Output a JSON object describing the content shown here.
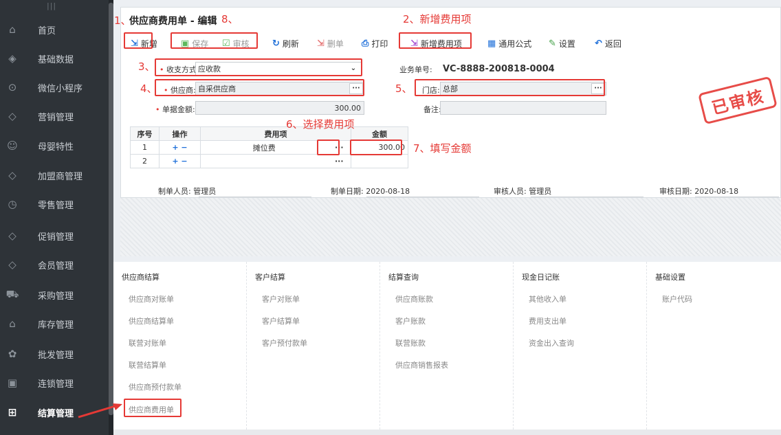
{
  "sidebar": {
    "grip": "|||",
    "items": [
      {
        "label": "首页",
        "icon": "home-icon"
      },
      {
        "label": "基础数据",
        "icon": "layers-icon"
      },
      {
        "label": "微信小程序",
        "icon": "mini-program-icon"
      },
      {
        "label": "营销管理",
        "icon": "diamond-icon"
      },
      {
        "label": "母婴特性",
        "icon": "smile-icon"
      },
      {
        "label": "加盟商管理",
        "icon": "handshake-icon"
      },
      {
        "label": "零售管理",
        "icon": "tag-icon"
      },
      {
        "label": "促销管理",
        "icon": "promo-tag-icon"
      },
      {
        "label": "会员管理",
        "icon": "member-diamond-icon"
      },
      {
        "label": "采购管理",
        "icon": "cart-icon"
      },
      {
        "label": "库存管理",
        "icon": "warehouse-icon"
      },
      {
        "label": "批发管理",
        "icon": "wholesale-icon"
      },
      {
        "label": "连锁管理",
        "icon": "chain-icon"
      },
      {
        "label": "结算管理",
        "icon": "settlement-icon"
      }
    ]
  },
  "form": {
    "title": "供应商费用单 - 编辑",
    "toolbar": {
      "add": "新增",
      "save": "保存",
      "audit": "审核",
      "refresh": "刷新",
      "delete": "删单",
      "print": "打印",
      "add_fee_item": "新增费用项",
      "formula": "通用公式",
      "settings": "设置",
      "back": "返回"
    },
    "fields": {
      "payment_label": "收支方式:",
      "payment_value": "应收款",
      "supplier_label": "供应商:",
      "supplier_value": "自采供应商",
      "amount_label": "单据金额:",
      "amount_value": "300.00",
      "bizno_label": "业务单号:",
      "bizno_value": "VC-8888-200818-0004",
      "store_label": "门店:",
      "store_value": "总部",
      "remark_label": "备注:",
      "remark_value": ""
    },
    "stamp": "已审核",
    "grid": {
      "headers": [
        "序号",
        "操作",
        "费用项",
        "金额"
      ],
      "rows": [
        {
          "no": "1",
          "ops": "+ −",
          "item": "摊位费",
          "dots": "···",
          "amount": "300.00"
        },
        {
          "no": "2",
          "ops": "+ −",
          "item": "",
          "dots": "···",
          "amount": ""
        }
      ]
    },
    "footer": {
      "creator_label": "制单人员:",
      "creator": "管理员",
      "create_date_label": "制单日期:",
      "create_date": "2020-08-18",
      "auditor_label": "审核人员:",
      "auditor": "管理员",
      "audit_date_label": "审核日期:",
      "audit_date": "2020-08-18"
    }
  },
  "annotations": {
    "n1": "1、",
    "n2": "2、新增费用项",
    "n3": "3、",
    "n4": "4、",
    "n5": "5、",
    "n6": "6、选择费用项",
    "n7": "7、填写金额",
    "n8": "8、"
  },
  "menu": {
    "columns": [
      {
        "title": "供应商结算",
        "links": [
          "供应商对账单",
          "供应商结算单",
          "联营对账单",
          "联营结算单",
          "供应商预付款单",
          "供应商费用单"
        ]
      },
      {
        "title": "客户结算",
        "links": [
          "客户对账单",
          "客户结算单",
          "客户预付款单"
        ]
      },
      {
        "title": "结算查询",
        "links": [
          "供应商账款",
          "客户账款",
          "联营账款",
          "供应商销售报表"
        ]
      },
      {
        "title": "现金日记账",
        "links": [
          "其他收入单",
          "费用支出单",
          "资金出入查询"
        ]
      },
      {
        "title": "基础设置",
        "links": [
          "账户代码"
        ]
      }
    ]
  },
  "colors": {
    "accent": "#e53935",
    "sidebar": "#2e3338",
    "blue": "#1e6fd9"
  }
}
